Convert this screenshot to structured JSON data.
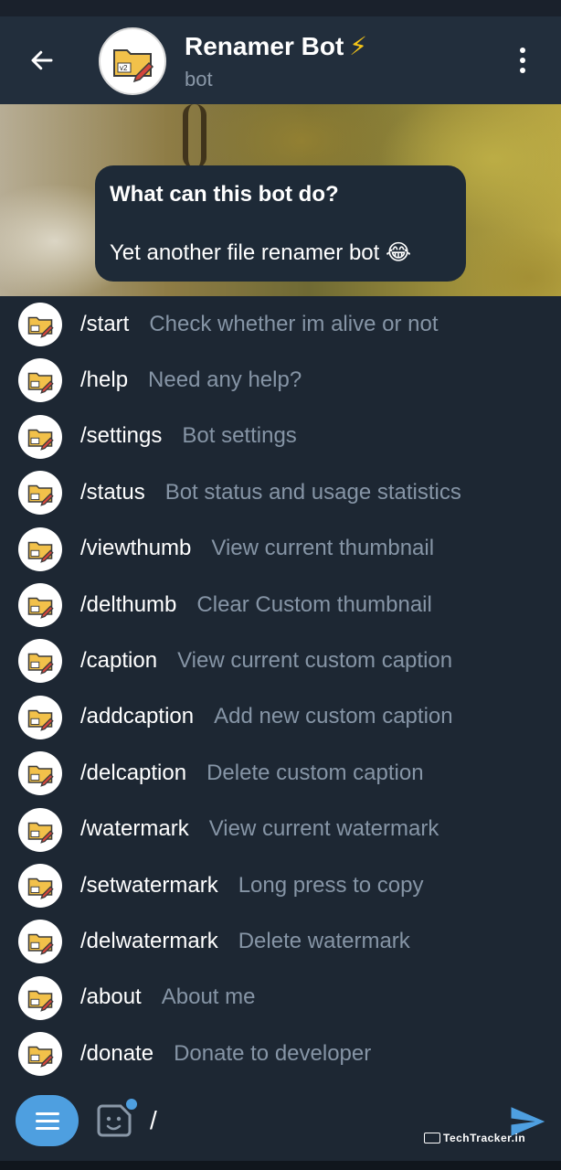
{
  "header": {
    "title": "Renamer Bot",
    "title_emoji": "⚡",
    "subtitle": "bot",
    "avatar_badge": "v2"
  },
  "bot_info": {
    "title": "What can this bot do?",
    "text": "Yet another file renamer bot 😂"
  },
  "commands": [
    {
      "name": "/start",
      "desc": "Check whether im alive or not"
    },
    {
      "name": "/help",
      "desc": "Need any help?"
    },
    {
      "name": "/settings",
      "desc": "Bot settings"
    },
    {
      "name": "/status",
      "desc": "Bot status and usage statistics"
    },
    {
      "name": "/viewthumb",
      "desc": "View current thumbnail"
    },
    {
      "name": "/delthumb",
      "desc": "Clear Custom thumbnail"
    },
    {
      "name": "/caption",
      "desc": "View current custom caption"
    },
    {
      "name": "/addcaption",
      "desc": "Add new custom caption"
    },
    {
      "name": "/delcaption",
      "desc": "Delete custom caption"
    },
    {
      "name": "/watermark",
      "desc": "View current watermark"
    },
    {
      "name": "/setwatermark",
      "desc": "Long press to copy"
    },
    {
      "name": "/delwatermark",
      "desc": "Delete watermark"
    },
    {
      "name": "/about",
      "desc": "About me"
    },
    {
      "name": "/donate",
      "desc": "Donate to developer"
    }
  ],
  "input": {
    "value": "/"
  },
  "watermark": {
    "text": "TechTracker.in"
  },
  "colors": {
    "accent": "#4e9fe0",
    "header_bg": "#222e3c",
    "list_bg": "#1d2733",
    "desc_text": "#8695a6"
  }
}
